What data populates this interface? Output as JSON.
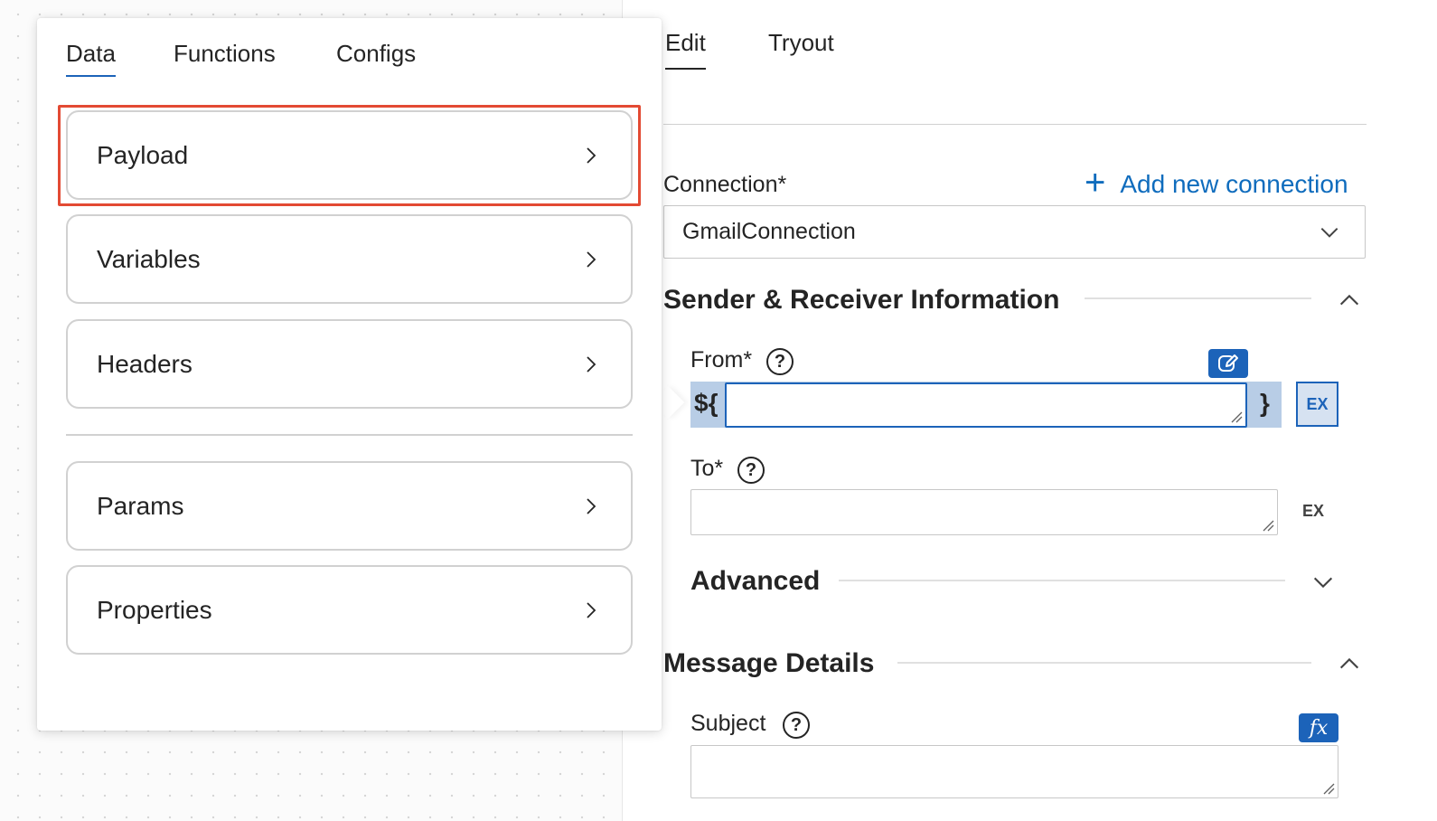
{
  "popover": {
    "tabs": [
      {
        "label": "Data"
      },
      {
        "label": "Functions"
      },
      {
        "label": "Configs"
      }
    ],
    "items": [
      {
        "label": "Payload"
      },
      {
        "label": "Variables"
      },
      {
        "label": "Headers"
      },
      {
        "label": "Params"
      },
      {
        "label": "Properties"
      }
    ]
  },
  "panel": {
    "tabs": [
      {
        "label": "Edit"
      },
      {
        "label": "Tryout"
      }
    ],
    "connection_label": "Connection*",
    "add_connection": "Add new connection",
    "connection_value": "GmailConnection",
    "sections": {
      "sender": "Sender & Receiver Information",
      "advanced": "Advanced",
      "message": "Message Details"
    },
    "fields": {
      "from_label": "From*",
      "to_label": "To*",
      "subject_label": "Subject",
      "expr_prefix": "${",
      "expr_suffix": "}",
      "ex_label": "EX",
      "fx_label": "fx",
      "help": "?"
    }
  },
  "colors": {
    "accent": "#1c63b9",
    "highlight": "#e34a33"
  }
}
